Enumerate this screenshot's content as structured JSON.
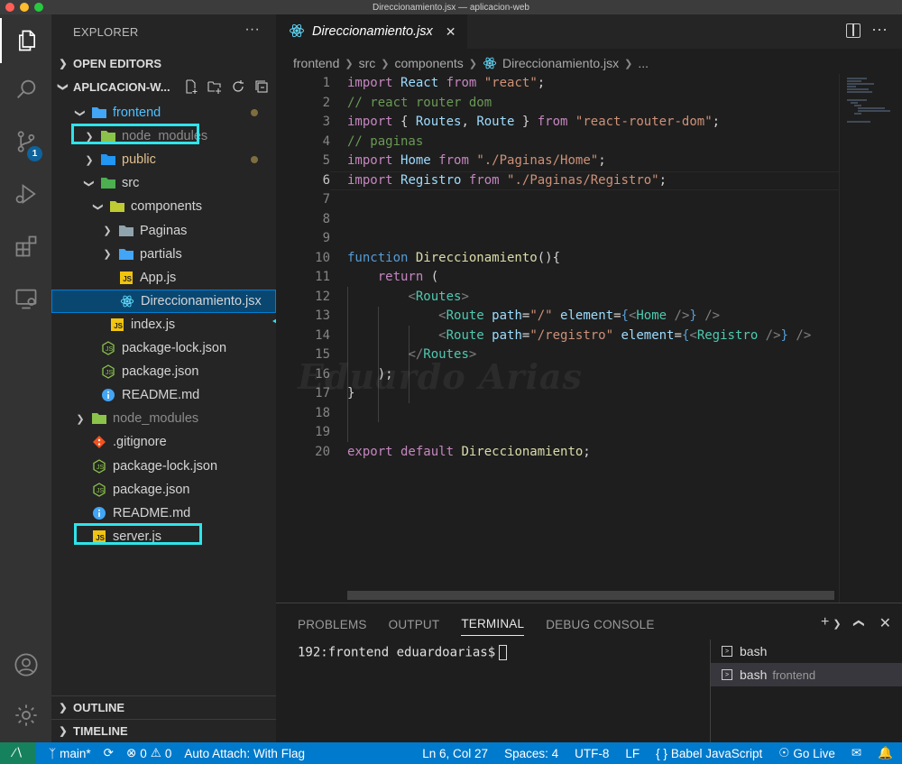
{
  "window": {
    "title": "Direccionamiento.jsx — aplicacion-web"
  },
  "activity": {
    "scm_badge": "1"
  },
  "explorer": {
    "header": "EXPLORER",
    "more": "···",
    "open_editors": "OPEN EDITORS",
    "project": "APLICACION-W...",
    "outline": "OUTLINE",
    "timeline": "TIMELINE",
    "tree": [
      {
        "label": "frontend",
        "indent": 1,
        "twisty": "open",
        "icon": "folder-blue-open-icon",
        "color": "#4fc1ff",
        "dot": true
      },
      {
        "label": "node_modules",
        "indent": 2,
        "twisty": "closed",
        "icon": "folder-node-icon",
        "dim": true
      },
      {
        "label": "public",
        "indent": 2,
        "twisty": "closed",
        "icon": "folder-public-icon",
        "color": "#e2c08d",
        "dot": true
      },
      {
        "label": "src",
        "indent": 2,
        "twisty": "open",
        "icon": "folder-src-open-icon"
      },
      {
        "label": "components",
        "indent": 3,
        "twisty": "open",
        "icon": "folder-components-open-icon"
      },
      {
        "label": "Paginas",
        "indent": 4,
        "twisty": "closed",
        "icon": "folder-icon"
      },
      {
        "label": "partials",
        "indent": 4,
        "twisty": "closed",
        "icon": "folder-partials-icon"
      },
      {
        "label": "App.js",
        "indent": 4,
        "twisty": "",
        "icon": "js-file-icon"
      },
      {
        "label": "Direccionamiento.jsx",
        "indent": 4,
        "twisty": "",
        "icon": "react-file-icon",
        "selected": true
      },
      {
        "label": "index.js",
        "indent": 3,
        "twisty": "",
        "icon": "js-file-icon"
      },
      {
        "label": "package-lock.json",
        "indent": 2,
        "twisty": "",
        "icon": "nodejs-file-icon"
      },
      {
        "label": "package.json",
        "indent": 2,
        "twisty": "",
        "icon": "nodejs-file-icon"
      },
      {
        "label": "README.md",
        "indent": 2,
        "twisty": "",
        "icon": "info-file-icon"
      },
      {
        "label": "node_modules",
        "indent": 1,
        "twisty": "closed",
        "icon": "folder-node-icon",
        "dim": true
      },
      {
        "label": ".gitignore",
        "indent": 1,
        "twisty": "",
        "icon": "git-file-icon"
      },
      {
        "label": "package-lock.json",
        "indent": 1,
        "twisty": "",
        "icon": "nodejs-file-icon"
      },
      {
        "label": "package.json",
        "indent": 1,
        "twisty": "",
        "icon": "nodejs-file-icon"
      },
      {
        "label": "README.md",
        "indent": 1,
        "twisty": "",
        "icon": "info-file-icon"
      },
      {
        "label": "server.js",
        "indent": 1,
        "twisty": "",
        "icon": "js-file-icon"
      }
    ]
  },
  "editor": {
    "tab_label": "Direccionamiento.jsx",
    "breadcrumb": [
      "frontend",
      "src",
      "components",
      "Direccionamiento.jsx",
      "..."
    ],
    "current_line": 6,
    "line_count": 20,
    "lines": [
      [
        [
          "k",
          "import "
        ],
        [
          "id",
          "React "
        ],
        [
          "k",
          "from "
        ],
        [
          "s",
          "\"react\""
        ],
        [
          "",
          "; "
        ]
      ],
      [
        [
          "c",
          "// react router dom"
        ]
      ],
      [
        [
          "k",
          "import "
        ],
        [
          "",
          "{ "
        ],
        [
          "id",
          "Routes"
        ],
        [
          "",
          ", "
        ],
        [
          "id",
          "Route "
        ],
        [
          "",
          "} "
        ],
        [
          "k",
          "from "
        ],
        [
          "s",
          "\"react-router-dom\""
        ],
        [
          "",
          ";"
        ]
      ],
      [
        [
          "c",
          "// paginas"
        ]
      ],
      [
        [
          "k",
          "import "
        ],
        [
          "id",
          "Home "
        ],
        [
          "k",
          "from "
        ],
        [
          "s",
          "\"./Paginas/Home\""
        ],
        [
          "",
          ";"
        ]
      ],
      [
        [
          "k",
          "import "
        ],
        [
          "id",
          "Registro "
        ],
        [
          "k",
          "from "
        ],
        [
          "s",
          "\"./Paginas/Registro\""
        ],
        [
          "",
          ";"
        ]
      ],
      [],
      [],
      [],
      [
        [
          "b",
          "function "
        ],
        [
          "f",
          "Direccionamiento"
        ],
        [
          "",
          "(){"
        ]
      ],
      [
        [
          "",
          "    "
        ],
        [
          "k",
          "return "
        ],
        [
          "",
          "("
        ]
      ],
      [
        [
          "",
          "        "
        ],
        [
          "p",
          "<"
        ],
        [
          "t",
          "Routes"
        ],
        [
          "p",
          ">"
        ]
      ],
      [
        [
          "",
          "            "
        ],
        [
          "p",
          "<"
        ],
        [
          "t",
          "Route "
        ],
        [
          "a",
          "path"
        ],
        [
          "",
          "="
        ],
        [
          "s",
          "\"/\" "
        ],
        [
          "a",
          "element"
        ],
        [
          "",
          "="
        ],
        [
          "b",
          "{"
        ],
        [
          "p",
          "<"
        ],
        [
          "t",
          "Home "
        ],
        [
          "p",
          "/>"
        ],
        [
          "b",
          "}"
        ],
        [
          "p",
          " />"
        ]
      ],
      [
        [
          "",
          "            "
        ],
        [
          "p",
          "<"
        ],
        [
          "t",
          "Route "
        ],
        [
          "a",
          "path"
        ],
        [
          "",
          "="
        ],
        [
          "s",
          "\"/registro\" "
        ],
        [
          "a",
          "element"
        ],
        [
          "",
          "="
        ],
        [
          "b",
          "{"
        ],
        [
          "p",
          "<"
        ],
        [
          "t",
          "Registro "
        ],
        [
          "p",
          "/>"
        ],
        [
          "b",
          "}"
        ],
        [
          "p",
          " />"
        ]
      ],
      [
        [
          "",
          "        "
        ],
        [
          "p",
          "</"
        ],
        [
          "t",
          "Routes"
        ],
        [
          "p",
          ">"
        ]
      ],
      [
        [
          "",
          "    "
        ],
        [
          "",
          ");"
        ]
      ],
      [
        [
          "",
          "}"
        ]
      ],
      [],
      [],
      [
        [
          "k",
          "export default "
        ],
        [
          "f",
          "Direccionamiento"
        ],
        [
          "",
          ";"
        ]
      ]
    ],
    "watermark": "Eduardo Arias"
  },
  "panel": {
    "tabs": [
      "PROBLEMS",
      "OUTPUT",
      "TERMINAL",
      "DEBUG CONSOLE"
    ],
    "active_tab": "TERMINAL",
    "prompt": "192:frontend eduardoarias$",
    "terminals": [
      {
        "name": "bash",
        "sub": ""
      },
      {
        "name": "bash",
        "sub": "frontend"
      }
    ]
  },
  "status": {
    "branch": "main*",
    "errors": "0",
    "warnings": "0",
    "auto_attach": "Auto Attach: With Flag",
    "position": "Ln 6, Col 27",
    "spaces": "Spaces: 4",
    "encoding": "UTF-8",
    "eol": "LF",
    "language": "Babel JavaScript",
    "golive": "Go Live"
  },
  "colors": {
    "accent": "#007acc",
    "annotation": "#2ee4ea",
    "selection": "#094771"
  }
}
